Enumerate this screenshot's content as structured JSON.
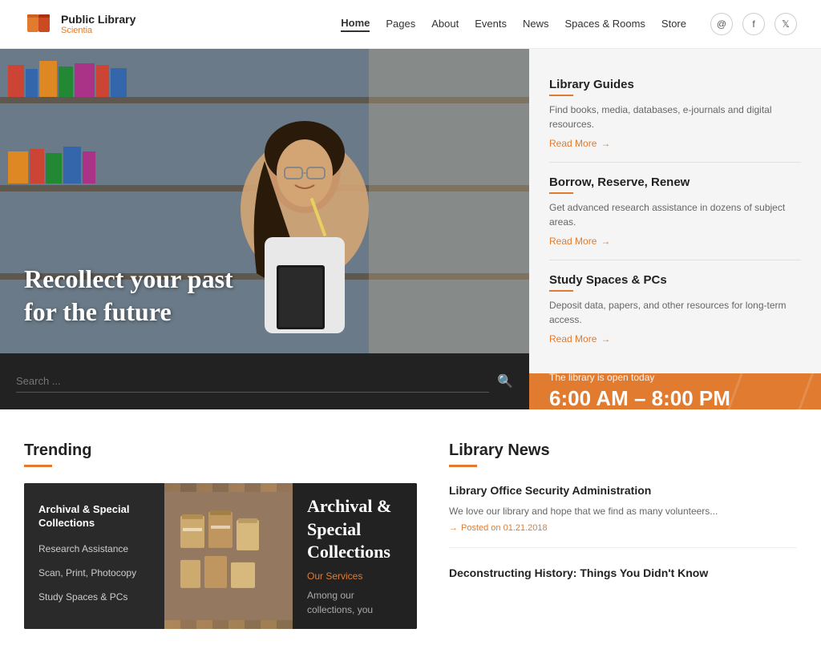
{
  "header": {
    "logo_title": "Public Library",
    "logo_subtitle": "Scientia",
    "nav_links": [
      {
        "label": "Home",
        "active": true
      },
      {
        "label": "Pages",
        "active": false
      },
      {
        "label": "About",
        "active": false
      },
      {
        "label": "Events",
        "active": false
      },
      {
        "label": "News",
        "active": false
      },
      {
        "label": "Spaces & Rooms",
        "active": false
      },
      {
        "label": "Store",
        "active": false
      }
    ],
    "nav_icons": [
      "@",
      "f",
      "t"
    ]
  },
  "hero": {
    "headline_line1": "Recollect your past",
    "headline_line2": "for the future",
    "search_placeholder": "Search ...",
    "open_today_label": "The library is open today",
    "open_hours": "6:00 AM – 8:00 PM"
  },
  "guides": [
    {
      "title": "Library Guides",
      "description": "Find books, media, databases, e-journals and digital resources.",
      "read_more": "Read More"
    },
    {
      "title": "Borrow, Reserve, Renew",
      "description": "Get advanced research assistance in dozens of subject areas.",
      "read_more": "Read More"
    },
    {
      "title": "Study Spaces & PCs",
      "description": "Deposit data, papers, and other resources for long-term access.",
      "read_more": "Read More"
    }
  ],
  "trending": {
    "section_title": "Trending",
    "menu_header_title": "Archival & Special Collections",
    "menu_items": [
      "Research Assistance",
      "Scan, Print, Photocopy",
      "Study Spaces & PCs"
    ],
    "content_tag": "Archival & Special Collections",
    "content_title": "Archival & Special Collections",
    "content_subtitle": "Our Services",
    "content_text": "Among our collections, you"
  },
  "library_news": {
    "section_title": "Library News",
    "items": [
      {
        "title": "Library Office Security Administration",
        "description": "We love our library and hope that we find as many volunteers...",
        "date": "Posted on 01.21.2018"
      },
      {
        "title": "Deconstructing History: Things You Didn't Know",
        "description": "",
        "date": ""
      }
    ]
  }
}
